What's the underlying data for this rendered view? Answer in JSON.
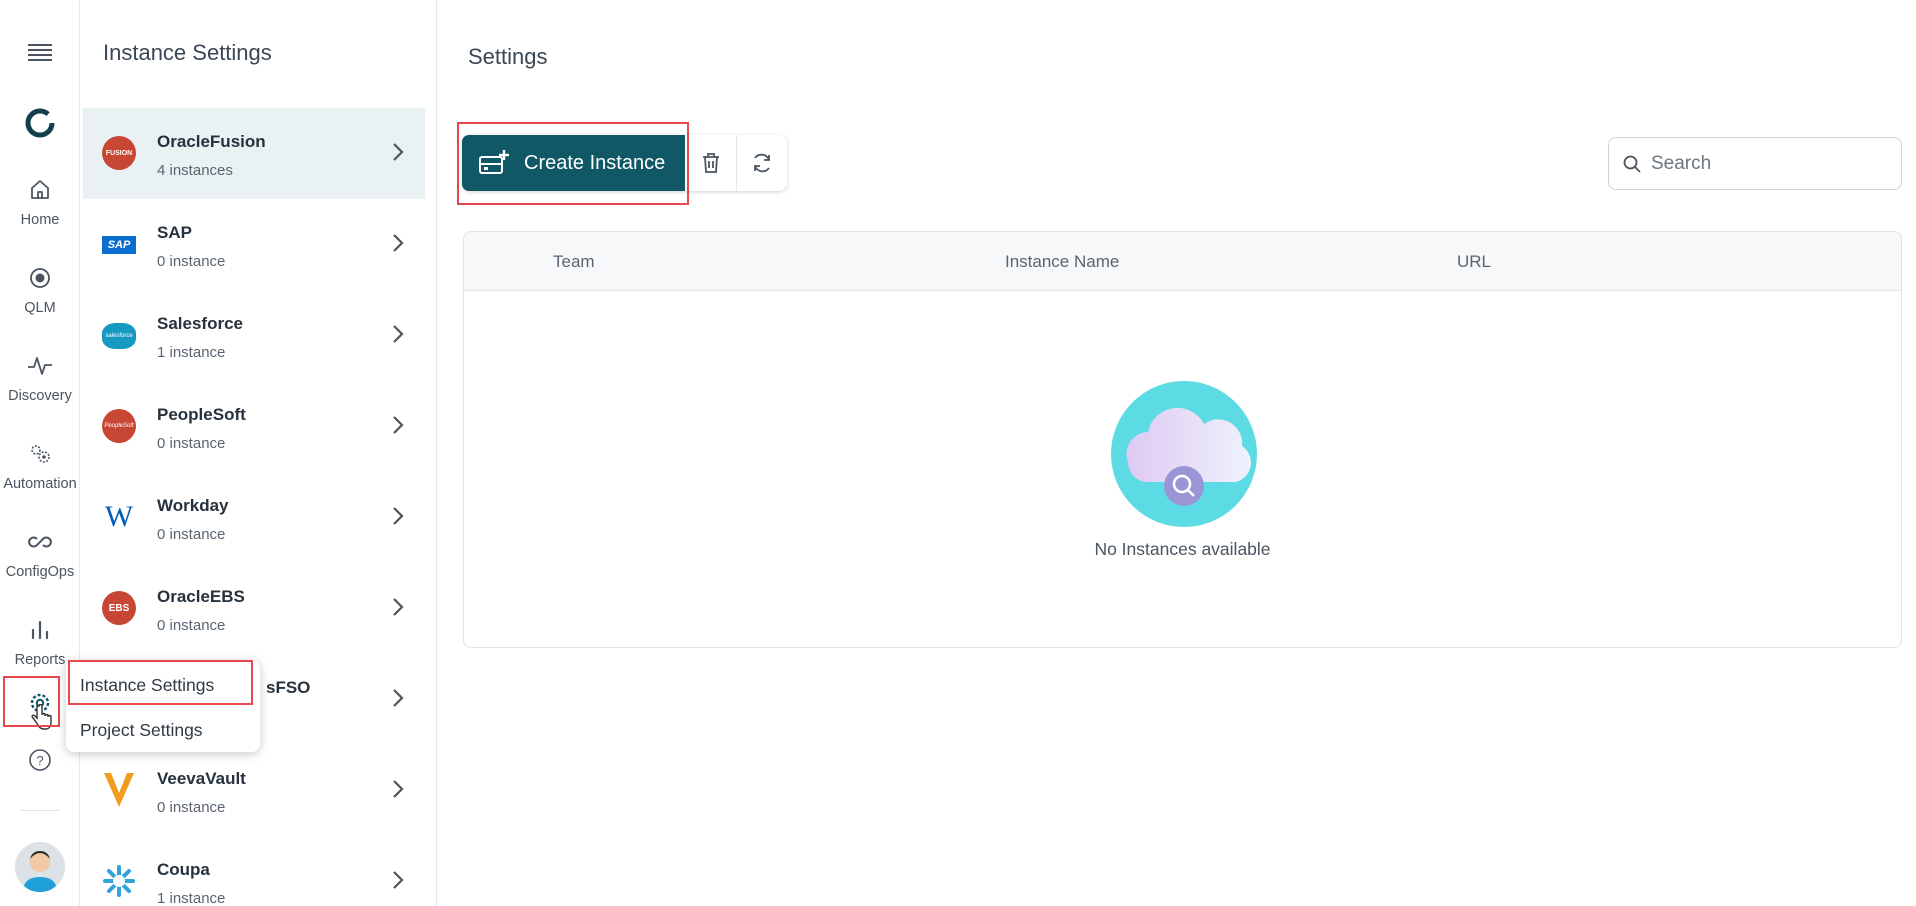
{
  "rail": {
    "items": [
      {
        "label": "Home"
      },
      {
        "label": "QLM"
      },
      {
        "label": "Discovery"
      },
      {
        "label": "Automation"
      },
      {
        "label": "ConfigOps"
      },
      {
        "label": "Reports"
      }
    ]
  },
  "panel": {
    "title": "Instance Settings",
    "apps": [
      {
        "name": "OracleFusion",
        "count": "4 instances",
        "logo_color": "#c74634",
        "logo_text": "FUSION"
      },
      {
        "name": "SAP",
        "count": "0 instance",
        "logo_color": "#0a6ed1",
        "logo_text": "SAP"
      },
      {
        "name": "Salesforce",
        "count": "1 instance",
        "logo_color": "#1798c1",
        "logo_text": "salesforce"
      },
      {
        "name": "PeopleSoft",
        "count": "0 instance",
        "logo_color": "#c74634",
        "logo_text": "PeopleSoft"
      },
      {
        "name": "Workday",
        "count": "0 instance",
        "logo_color": "#005cb9",
        "logo_text": "W"
      },
      {
        "name": "OracleEBS",
        "count": "0 instance",
        "logo_color": "#c74634",
        "logo_text": "EBS"
      },
      {
        "name": "sFSO",
        "count": "",
        "logo_color": "#c74634",
        "logo_text": ""
      },
      {
        "name": "VeevaVault",
        "count": "0 instance",
        "logo_color": "#f29c1f",
        "logo_text": "V"
      },
      {
        "name": "Coupa",
        "count": "1 instance",
        "logo_color": "#31a4dc",
        "logo_text": ""
      }
    ]
  },
  "main": {
    "title": "Settings",
    "create_label": "Create Instance",
    "search_placeholder": "Search",
    "columns": [
      "Team",
      "Instance Name",
      "URL"
    ],
    "empty_text": "No Instances available",
    "accent_color": "#105866"
  },
  "popup": {
    "items": [
      {
        "label": "Instance Settings"
      },
      {
        "label": "Project Settings"
      }
    ]
  }
}
